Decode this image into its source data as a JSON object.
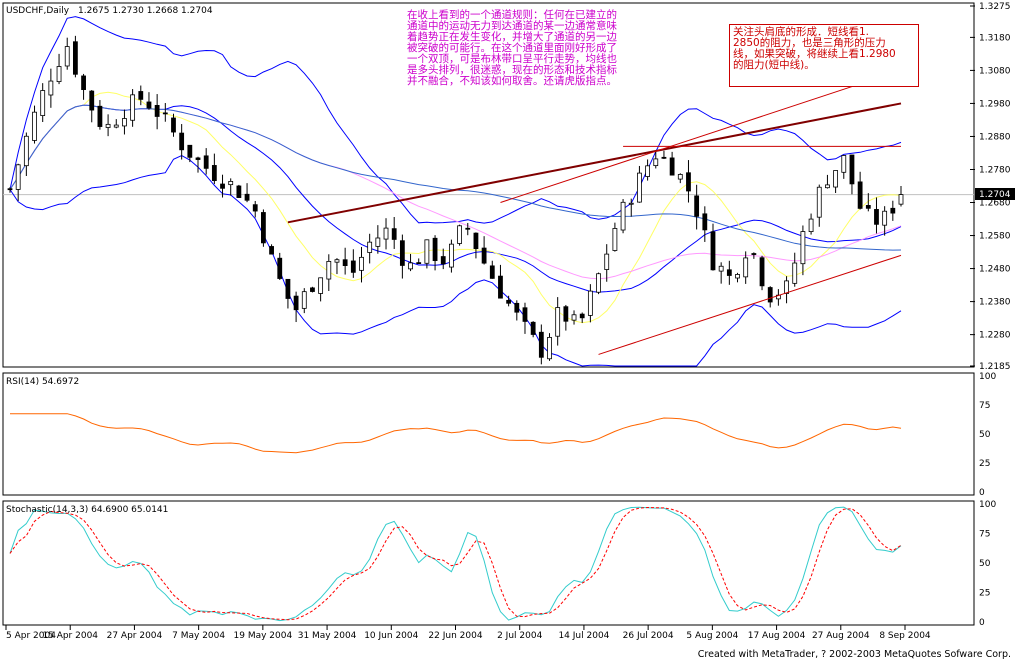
{
  "header": {
    "symbol_label": "USDCHF,Daily",
    "ohlc": "1.2675  1.2730  1.2668  1.2704"
  },
  "price_axis": {
    "ticks": [
      "1.3275",
      "1.3180",
      "1.3080",
      "1.2980",
      "1.2880",
      "1.2780",
      "1.2680",
      "1.2580",
      "1.2480",
      "1.2380",
      "1.2280",
      "1.2185"
    ],
    "current_price_label": "1.2704"
  },
  "rsi": {
    "label": "RSI(14)  54.6972",
    "ticks": [
      "100",
      "75",
      "50",
      "25",
      "0"
    ]
  },
  "stochastic": {
    "label": "Stochastic(14,3,3)  64.6900  65.0141",
    "ticks": [
      "100",
      "75",
      "50",
      "25",
      "0"
    ]
  },
  "time_axis": {
    "ticks": [
      "5 Apr 2004",
      "15 Apr 2004",
      "27 Apr 2004",
      "7 May 2004",
      "19 May 2004",
      "31 May 2004",
      "10 Jun 2004",
      "22 Jun 2004",
      "2 Jul 2004",
      "14 Jul 2004",
      "26 Jul 2004",
      "5 Aug 2004",
      "17 Aug 2004",
      "27 Aug 2004",
      "8 Sep 2004"
    ]
  },
  "notes": {
    "left_note": "在收上看到的一个通道规则：任何在已建立的\n通道中的运动无力到达通道的某一边通常意味\n着趋势正在发生变化，并增大了通道的另一边\n被突破的可能行。在这个通道里面刚好形成了\n一个双顶，可是布林带口呈平行走势，均线也\n是多头排列，很迷惑，现在的形态和技术指标\n并不融合，不知该如何取舍。还请虎版指点。",
    "right_note": "关注头肩底的形成．短线看1.\n2850的阻力，也是三角形的压力\n线，如果突破，将继续上看1.2980\n的阻力(短中线)。"
  },
  "footer": {
    "credit": "Created with MetaTrader, ? 2002-2003 MetaQuotes Sofware Corp."
  },
  "colors": {
    "bull_body": "#ffffff",
    "bear_body": "#000000",
    "bollinger": "#0000ff",
    "ma_yellow": "#ffff66",
    "ma_pink": "#ff99ff",
    "ma_blue": "#3366cc",
    "rsi_line": "#ff6600",
    "stoch_main": "#33cccc",
    "stoch_signal": "#ff0000",
    "trendline_dark": "#800000",
    "trendline_red": "#cc0000",
    "note_text": "#cc00cc",
    "note2_text": "#cc0000"
  },
  "chart_data": {
    "type": "candlestick",
    "symbol": "USDCHF",
    "timeframe": "Daily",
    "last_bar": {
      "open": 1.2675,
      "high": 1.273,
      "low": 1.2668,
      "close": 1.2704
    },
    "ylim": [
      1.2185,
      1.3275
    ],
    "x": [
      "5 Apr 2004",
      "15 Apr 2004",
      "27 Apr 2004",
      "7 May 2004",
      "19 May 2004",
      "31 May 2004",
      "10 Jun 2004",
      "22 Jun 2004",
      "2 Jul 2004",
      "14 Jul 2004",
      "26 Jul 2004",
      "5 Aug 2004",
      "17 Aug 2004",
      "27 Aug 2004",
      "8 Sep 2004"
    ],
    "close_path": [
      1.272,
      1.29,
      1.305,
      1.316,
      1.3,
      1.29,
      1.296,
      1.3,
      1.294,
      1.286,
      1.28,
      1.276,
      1.272,
      1.265,
      1.247,
      1.235,
      1.244,
      1.252,
      1.246,
      1.256,
      1.26,
      1.248,
      1.254,
      1.25,
      1.262,
      1.25,
      1.24,
      1.231,
      1.223,
      1.235,
      1.23,
      1.245,
      1.262,
      1.273,
      1.283,
      1.279,
      1.27,
      1.251,
      1.245,
      1.256,
      1.24,
      1.242,
      1.262,
      1.275,
      1.281,
      1.264,
      1.262,
      1.2704
    ],
    "rsi": {
      "period": 14,
      "last": 54.6972,
      "ylim": [
        0,
        100
      ]
    },
    "stochastic": {
      "params": [
        14,
        3,
        3
      ],
      "main_last": 64.69,
      "signal_last": 65.0141,
      "ylim": [
        0,
        100
      ]
    }
  }
}
